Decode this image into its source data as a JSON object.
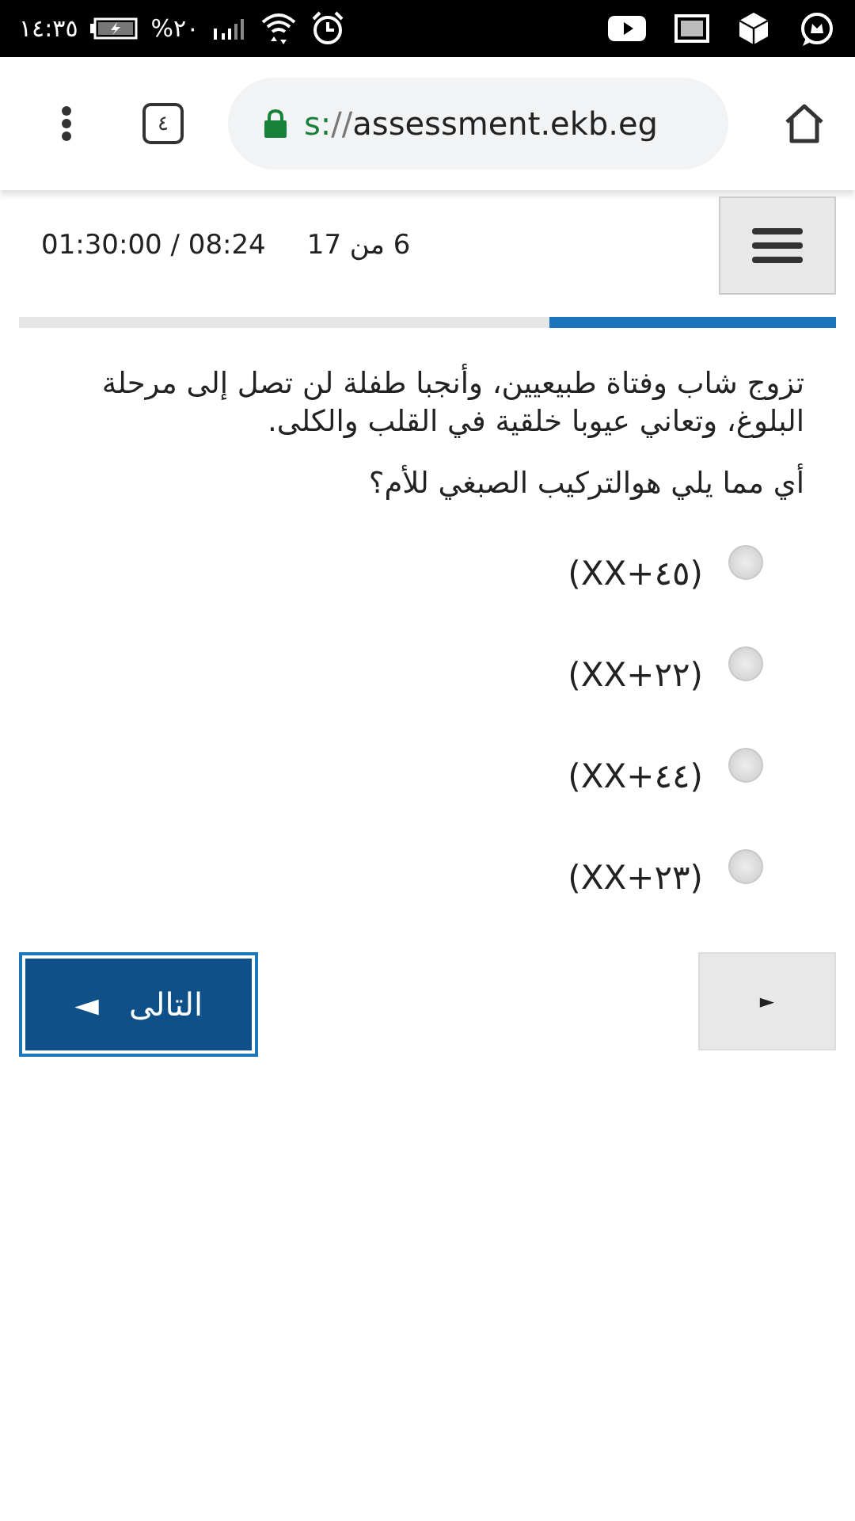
{
  "status_bar": {
    "time": "١٤:٣٥",
    "battery": "%٢٠"
  },
  "browser": {
    "tab_count": "٤",
    "url_scheme": "s:",
    "url_rest": "//assessment.ekb.eg"
  },
  "quiz_header": {
    "page": "6 من 17",
    "timer": "01:30:00 / 08:24"
  },
  "progress": {
    "level": 0.35
  },
  "question": {
    "text": "تزوج شاب وفتاة طبيعيين، وأنجبا طفلة لن تصل إلى مرحلة البلوغ، وتعاني عيوبا خلقية في القلب والكلى.",
    "prompt": "أي مما يلي هوالتركيب الصبغي للأم؟"
  },
  "options": [
    {
      "label": "(XX+٤٥)",
      "selected": false
    },
    {
      "label": "(XX+٢٢)",
      "selected": false
    },
    {
      "label": "(XX+٤٤)",
      "selected": false
    },
    {
      "label": "(XX+٢٣)",
      "selected": false
    }
  ],
  "buttons": {
    "next": {
      "label": "التالى",
      "arrow": "◄"
    },
    "nav": {
      "arrow": "►"
    }
  }
}
